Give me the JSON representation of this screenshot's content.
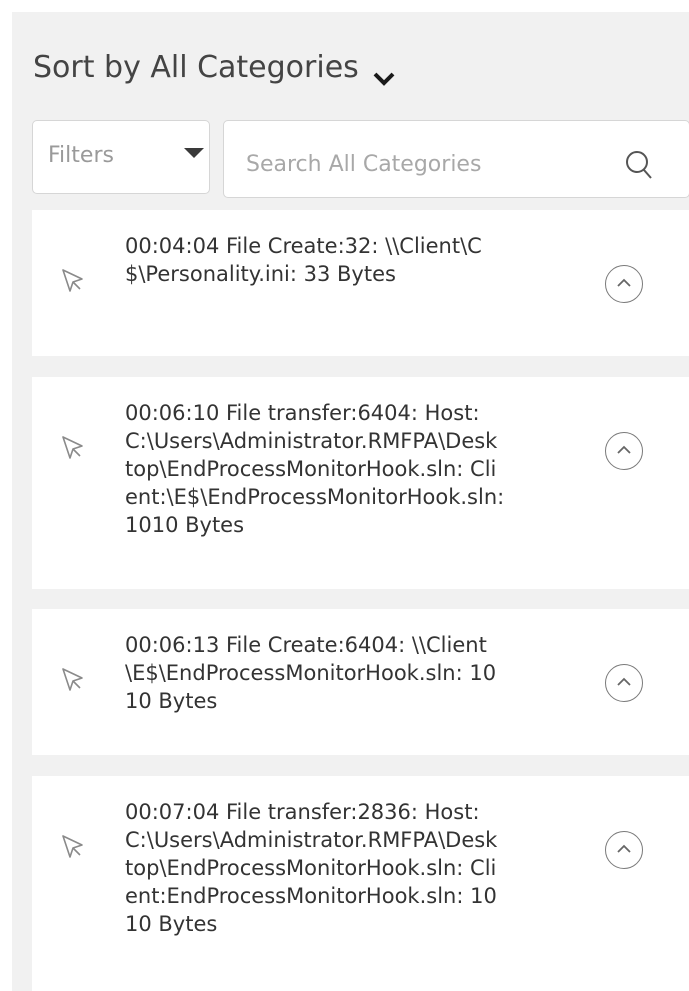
{
  "sort": {
    "label": "Sort by All Categories"
  },
  "filters": {
    "label": "Filters"
  },
  "search": {
    "placeholder": "Search All Categories"
  },
  "events": [
    {
      "text": "00:04:04 File Create:32: \\\\Client\\C$\\Personality.ini: 33 Bytes",
      "icon": "cursor-icon"
    },
    {
      "text": "00:06:10 File transfer:6404: Host:C:\\Users\\Administrator.RMFPA\\Desktop\\EndProcessMonitorHook.sln: Client:\\E$\\EndProcessMonitorHook.sln: 1010 Bytes",
      "icon": "cursor-icon"
    },
    {
      "text": "00:06:13 File Create:6404: \\\\Client\\E$\\EndProcessMonitorHook.sln: 1010 Bytes",
      "icon": "cursor-icon"
    },
    {
      "text": "00:07:04 File transfer:2836: Host:C:\\Users\\Administrator.RMFPA\\Desktop\\EndProcessMonitorHook.sln: Client:EndProcessMonitorHook.sln: 1010 Bytes",
      "icon": "cursor-icon"
    }
  ],
  "colors": {
    "panel_background": "#f1f1f1",
    "card_background": "#ffffff",
    "text": "#333333",
    "placeholder": "#a8a8a8"
  }
}
